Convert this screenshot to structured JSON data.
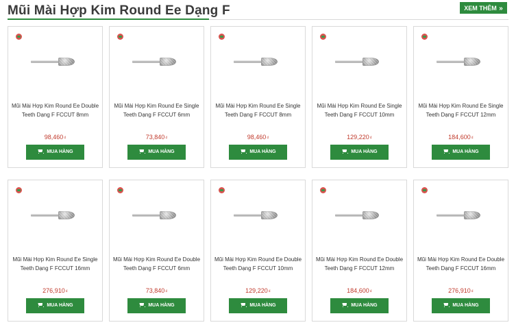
{
  "section": {
    "title": "Mũi Mài Hợp Kim Round Ee Dạng F",
    "more_label": "XEM THÊM",
    "more_arrow": "»"
  },
  "colors": {
    "accent": "#2e8b3e",
    "price": "#c0392b"
  },
  "currency": "₫",
  "buy_label": "MUA HÀNG",
  "products": [
    {
      "name": "Mũi Mài Hợp Kim Round Ee Double Teeth Dạng F FCCUT 8mm",
      "price": "98,460"
    },
    {
      "name": "Mũi Mài Hợp Kim Round Ee Single Teeth Dạng F FCCUT 6mm",
      "price": "73,840"
    },
    {
      "name": "Mũi Mài Hợp Kim Round Ee Single Teeth Dạng F FCCUT 8mm",
      "price": "98,460"
    },
    {
      "name": "Mũi Mài Hợp Kim Round Ee Single Teeth Dạng F FCCUT 10mm",
      "price": "129,220"
    },
    {
      "name": "Mũi Mài Hợp Kim Round Ee Single Teeth Dạng F FCCUT 12mm",
      "price": "184,600"
    },
    {
      "name": "Mũi Mài Hợp Kim Round Ee Single Teeth Dạng F FCCUT 16mm",
      "price": "276,910"
    },
    {
      "name": "Mũi Mài Hợp Kim Round Ee Double Teeth Dạng F FCCUT 6mm",
      "price": "73,840"
    },
    {
      "name": "Mũi Mài Hợp Kim Round Ee Double Teeth Dạng F FCCUT 10mm",
      "price": "129,220"
    },
    {
      "name": "Mũi Mài Hợp Kim Round Ee Double Teeth Dạng F FCCUT 12mm",
      "price": "184,600"
    },
    {
      "name": "Mũi Mài Hợp Kim Round Ee Double Teeth Dạng F FCCUT 16mm",
      "price": "276,910"
    }
  ]
}
